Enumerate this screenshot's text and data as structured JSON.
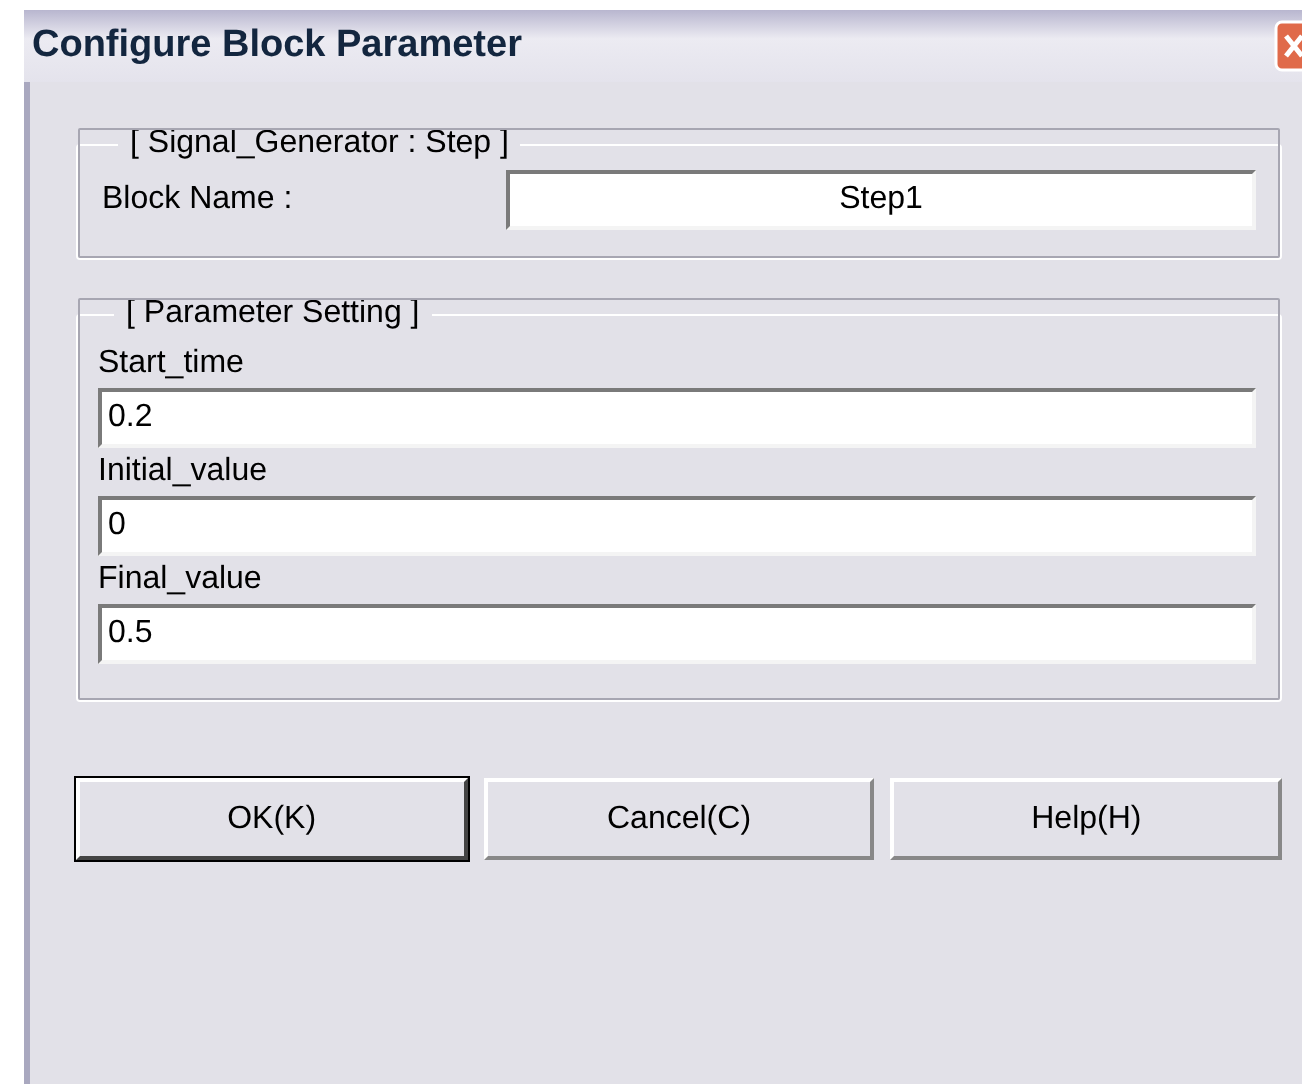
{
  "window": {
    "title": "Configure Block Parameter"
  },
  "block_group": {
    "title": "[ Signal_Generator : Step ]",
    "label": "Block Name :",
    "value": "Step1"
  },
  "parameter_group": {
    "title": "[ Parameter Setting ]",
    "fields": [
      {
        "label": "Start_time",
        "value": "0.2"
      },
      {
        "label": "Initial_value",
        "value": "0"
      },
      {
        "label": "Final_value",
        "value": "0.5"
      }
    ]
  },
  "buttons": [
    {
      "label": "OK(K)",
      "default": true
    },
    {
      "label": "Cancel(C)",
      "default": false
    },
    {
      "label": "Help(H)",
      "default": false
    }
  ]
}
